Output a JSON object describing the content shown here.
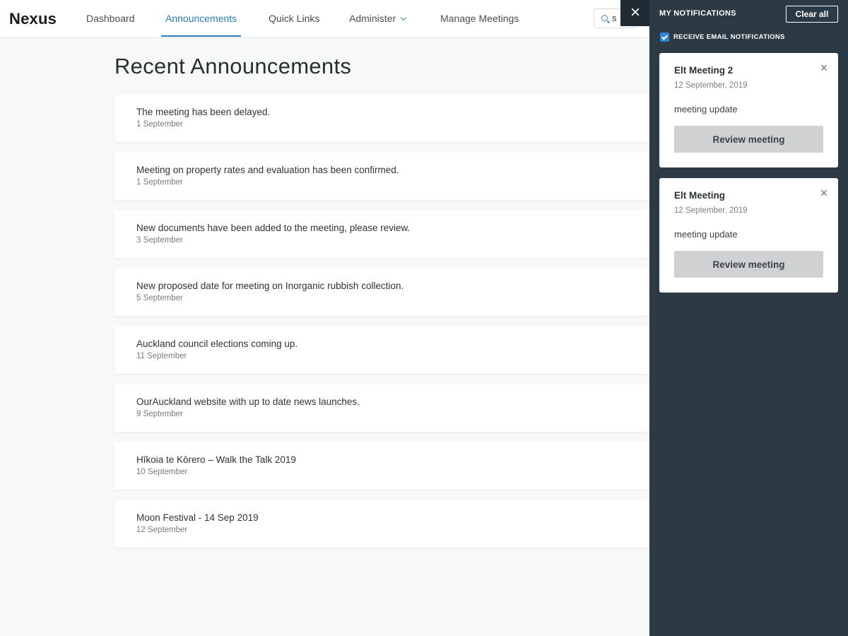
{
  "app": {
    "name": "Nexus"
  },
  "nav": {
    "items": [
      {
        "label": "Dashboard"
      },
      {
        "label": "Announcements"
      },
      {
        "label": "Quick Links"
      },
      {
        "label": "Administer"
      },
      {
        "label": "Manage Meetings"
      }
    ],
    "active_index": 1,
    "search_value": "s"
  },
  "main": {
    "title": "Recent Announcements",
    "announcements": [
      {
        "title": "The meeting has been delayed.",
        "date": "1 September"
      },
      {
        "title": "Meeting on property rates and evaluation has been confirmed.",
        "date": "1 September"
      },
      {
        "title": "New documents have been added to the meeting, please review.",
        "date": "3 September"
      },
      {
        "title": "New proposed date for meeting on Inorganic rubbish collection.",
        "date": "5 September"
      },
      {
        "title": "Auckland council elections coming up.",
        "date": "11 September"
      },
      {
        "title": "OurAuckland website with up to date news launches.",
        "date": "9 September"
      },
      {
        "title": "Hīkoia te Kōrero – Walk the Talk 2019",
        "date": "10 September"
      },
      {
        "title": "Moon Festival - 14 Sep 2019",
        "date": "12 September"
      }
    ]
  },
  "notifications": {
    "title": "MY NOTIFICATIONS",
    "clear_label": "Clear all",
    "email_label": "RECEIVE EMAIL NOTIFICATIONS",
    "email_checked": true,
    "items": [
      {
        "title": "Elt Meeting 2",
        "date": "12 September, 2019",
        "body": "meeting update",
        "action": "Review meeting"
      },
      {
        "title": "Elt Meeting",
        "date": "12 September, 2019",
        "body": "meeting update",
        "action": "Review meeting"
      }
    ]
  },
  "icons": {
    "close": "×",
    "search": "magnifier",
    "dropdown": "chevron-down"
  },
  "colors": {
    "accent": "#2a7bb6",
    "panel_bg": "#2b3a45",
    "checkbox": "#2f86d2"
  }
}
